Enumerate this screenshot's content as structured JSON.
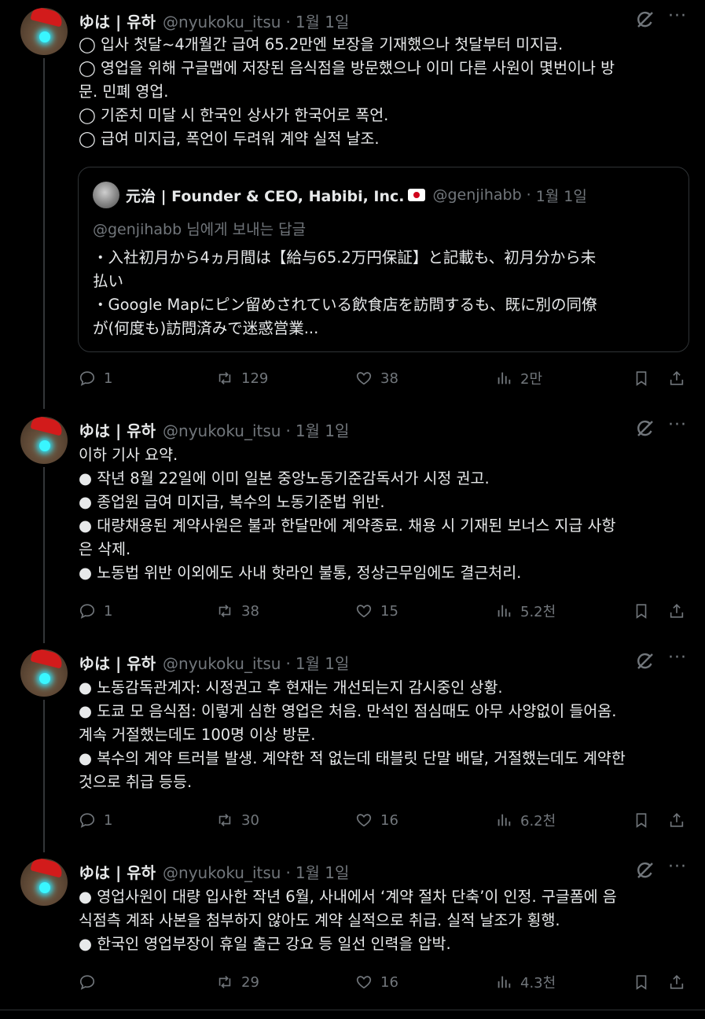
{
  "tweets": [
    {
      "name": "ゆは | 유하",
      "handle": "@nyukoku_itsu",
      "date": "1월 1일",
      "lines": [
        "◯ 입사 첫달~4개월간 급여 65.2만엔 보장을 기재했으나 첫달부터 미지급.",
        "◯ 영업을 위해 구글맵에 저장된 음식점을 방문했으나 이미 다른 사원이 몇번이나 방",
        "문. 민폐 영업.",
        "◯ 기준치 미달 시 한국인 상사가 한국어로 폭언.",
        "◯ 급여 미지급, 폭언이 두려워 계약 실적 날조."
      ],
      "quote": {
        "name": "元治 | Founder & CEO, Habibi, Inc.",
        "handle": "@genjihabb",
        "date": "1월 1일",
        "reply_to": "@genjihabb 님에게 보내는 답글",
        "lines": [
          "・入社初月から4ヵ月間は【給与65.2万円保証】と記載も、初月分から未",
          "払い",
          "・Google Mapにピン留めされている飲食店を訪問するも、既に別の同僚",
          "が(何度も)訪問済みで迷惑営業..."
        ]
      },
      "replies": "1",
      "retweets": "129",
      "likes": "38",
      "views": "2만"
    },
    {
      "name": "ゆは | 유하",
      "handle": "@nyukoku_itsu",
      "date": "1월 1일",
      "lines": [
        "이하 기사 요약.",
        "● 작년 8월 22일에 이미 일본 중앙노동기준감독서가 시정 권고.",
        "● 종업원 급여 미지급, 복수의 노동기준법 위반.",
        "● 대량채용된 계약사원은 불과 한달만에 계약종료. 채용 시 기재된 보너스 지급 사항",
        "은 삭제.",
        "● 노동법 위반 이외에도 사내 핫라인 불통, 정상근무임에도 결근처리."
      ],
      "replies": "1",
      "retweets": "38",
      "likes": "15",
      "views": "5.2천"
    },
    {
      "name": "ゆは | 유하",
      "handle": "@nyukoku_itsu",
      "date": "1월 1일",
      "lines": [
        "● 노동감독관계자: 시정권고 후 현재는 개선되는지 감시중인 상황.",
        "● 도쿄 모 음식점: 이렇게 심한 영업은 처음. 만석인 점심때도 아무 사양없이 들어옴.",
        "계속 거절했는데도 100명 이상 방문.",
        "● 복수의 계약 트러블 발생. 계약한 적 없는데 태블릿 단말 배달, 거절했는데도 계약한",
        "것으로 취급 등등."
      ],
      "replies": "1",
      "retweets": "30",
      "likes": "16",
      "views": "6.2천"
    },
    {
      "name": "ゆは | 유하",
      "handle": "@nyukoku_itsu",
      "date": "1월 1일",
      "lines": [
        "● 영업사원이 대량 입사한 작년 6월, 사내에서 ‘계약 절차 단축’이 인정. 구글폼에 음",
        "식점측 계좌 사본을 첨부하지 않아도 계약 실적으로 취급. 실적 날조가 횡행.",
        "● 한국인 영업부장이 휴일 출근 강요 등 일선 인력을 압박."
      ],
      "replies": "",
      "retweets": "29",
      "likes": "16",
      "views": "4.3천"
    }
  ],
  "icons": {
    "avatar": "capybara-avatar",
    "grok": "grok-icon",
    "more": "more-icon",
    "reply": "reply-icon",
    "retweet": "retweet-icon",
    "like": "heart-icon",
    "views": "views-icon",
    "bookmark": "bookmark-icon",
    "share": "share-icon"
  },
  "colors": {
    "background": "#000000",
    "text": "#e7e9ea",
    "muted": "#71767b",
    "border": "#2f3336"
  }
}
